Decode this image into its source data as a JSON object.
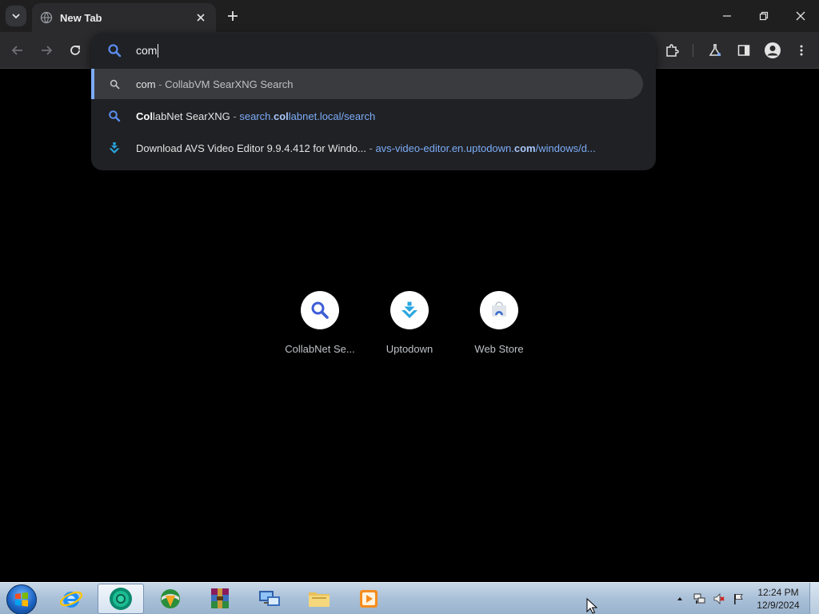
{
  "tab": {
    "title": "New Tab"
  },
  "omnibox": {
    "input_value": "com",
    "suggestions": [
      {
        "primary": "com",
        "separator": " - ",
        "secondary": "CollabVM SearXNG Search"
      },
      {
        "primary_bold": "Col",
        "primary_rest": "labNet SearXNG",
        "separator": " - ",
        "url_pre": "search.",
        "url_bold": "col",
        "url_post": "labnet.local/search"
      },
      {
        "primary": "Download AVS Video Editor 9.9.4.412 for Windo...",
        "separator": " - ",
        "url_pre": "avs-video-editor.en.uptodown.",
        "url_bold": "com",
        "url_post": "/windows/d..."
      }
    ]
  },
  "shortcuts": [
    {
      "label": "CollabNet Se...",
      "icon": "search-icon"
    },
    {
      "label": "Uptodown",
      "icon": "uptodown-icon"
    },
    {
      "label": "Web Store",
      "icon": "web-store-icon"
    }
  ],
  "taskbar": {
    "apps": [
      "internet-explorer-icon",
      "chrome-icon",
      "internet-download-manager-icon",
      "winrar-icon",
      "remote-desktop-icon",
      "file-explorer-icon",
      "media-player-icon"
    ],
    "clock_time": "12:24 PM",
    "clock_date": "12/9/2024"
  },
  "colors": {
    "accent_blue": "#7cacf8",
    "omnibox_bg": "#202124",
    "toolbar_bg": "#2b2b2d"
  }
}
